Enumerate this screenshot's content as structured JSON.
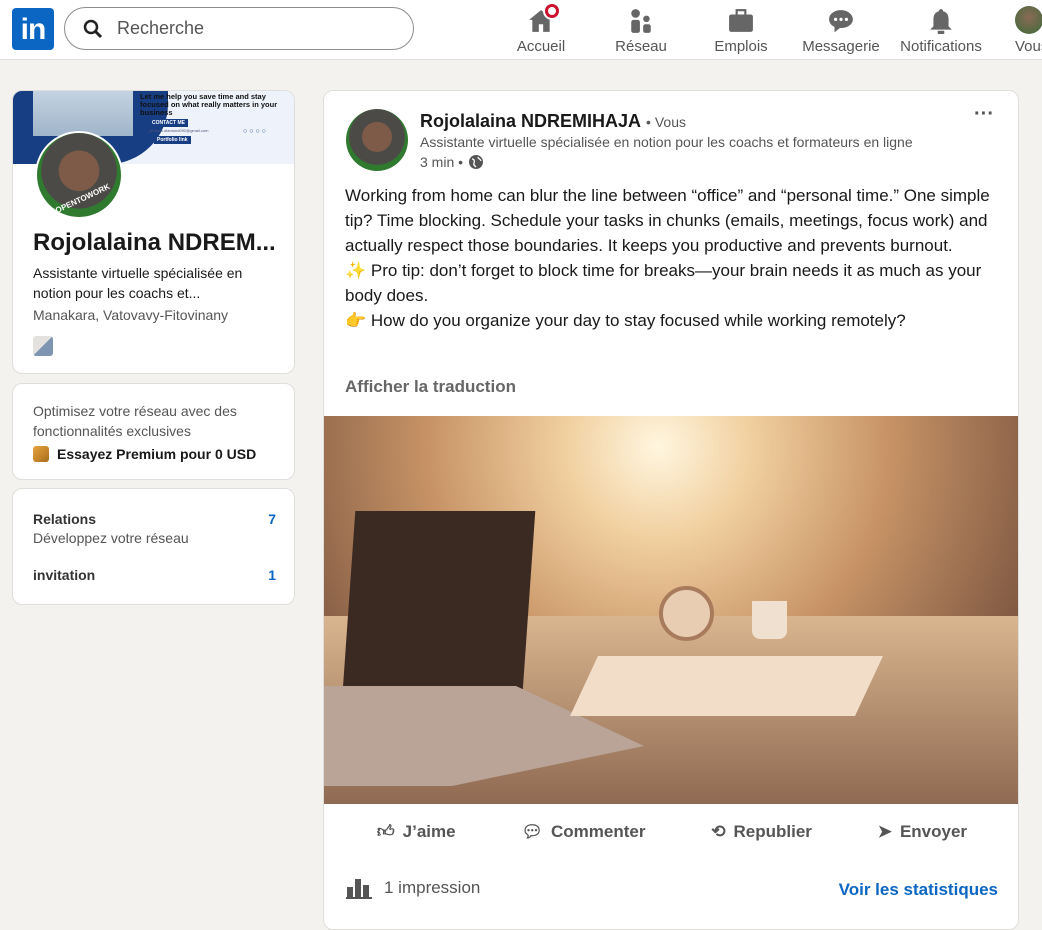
{
  "nav": {
    "search_placeholder": "Recherche",
    "items": [
      "Accueil",
      "Réseau",
      "Emplois",
      "Messagerie",
      "Notifications",
      "Vous"
    ]
  },
  "profile": {
    "name": "Rojolalaina NDREM...",
    "headline": "Assistante virtuelle spécialisée en notion pour les coachs et...",
    "location": "Manakara, Vatovavy-Fitovinany",
    "badge": "#OPENTOWORK",
    "banner": {
      "tagline": "Let me help you save time and stay focused on what really matters in your business",
      "contact": "CONTACT ME",
      "email": "phoenix.diamond092@gmail.com",
      "portfolio": "Portfolio link"
    }
  },
  "premium": {
    "text": "Optimisez votre réseau avec des fonctionnalités exclusives",
    "cta": "Essayez Premium pour 0 USD"
  },
  "network": {
    "relations_label": "Relations",
    "relations_sub": "Développez votre réseau",
    "relations_count": "7",
    "invitation_label": "invitation",
    "invitation_count": "1"
  },
  "post": {
    "author": "Rojolalaina NDREMIHAJA",
    "you": "• Vous",
    "headline": "Assistante virtuelle spécialisée en notion pour les coachs et formateurs en ligne",
    "time": "3 min •",
    "more": "···",
    "p1": "Working from home can blur the line between “office” and “personal time.” One simple tip? Time blocking. Schedule your tasks in chunks (emails, meetings, focus work) and actually respect those boundaries. It keeps you productive and prevents burnout.",
    "p2": "✨ Pro tip: don’t forget to block time for breaks—your brain needs it as much as your body does.",
    "p3": "👉 How do you organize your day to stay focused while working remotely?",
    "translate": "Afficher la traduction",
    "actions": [
      "J’aime",
      "Commenter",
      "Republier",
      "Envoyer"
    ],
    "impressions": "1 impression",
    "stats": "Voir les statistiques"
  },
  "colors": {
    "brand": "#0a66c2",
    "badge": "#cb112d",
    "page": "#f4f2ee"
  }
}
